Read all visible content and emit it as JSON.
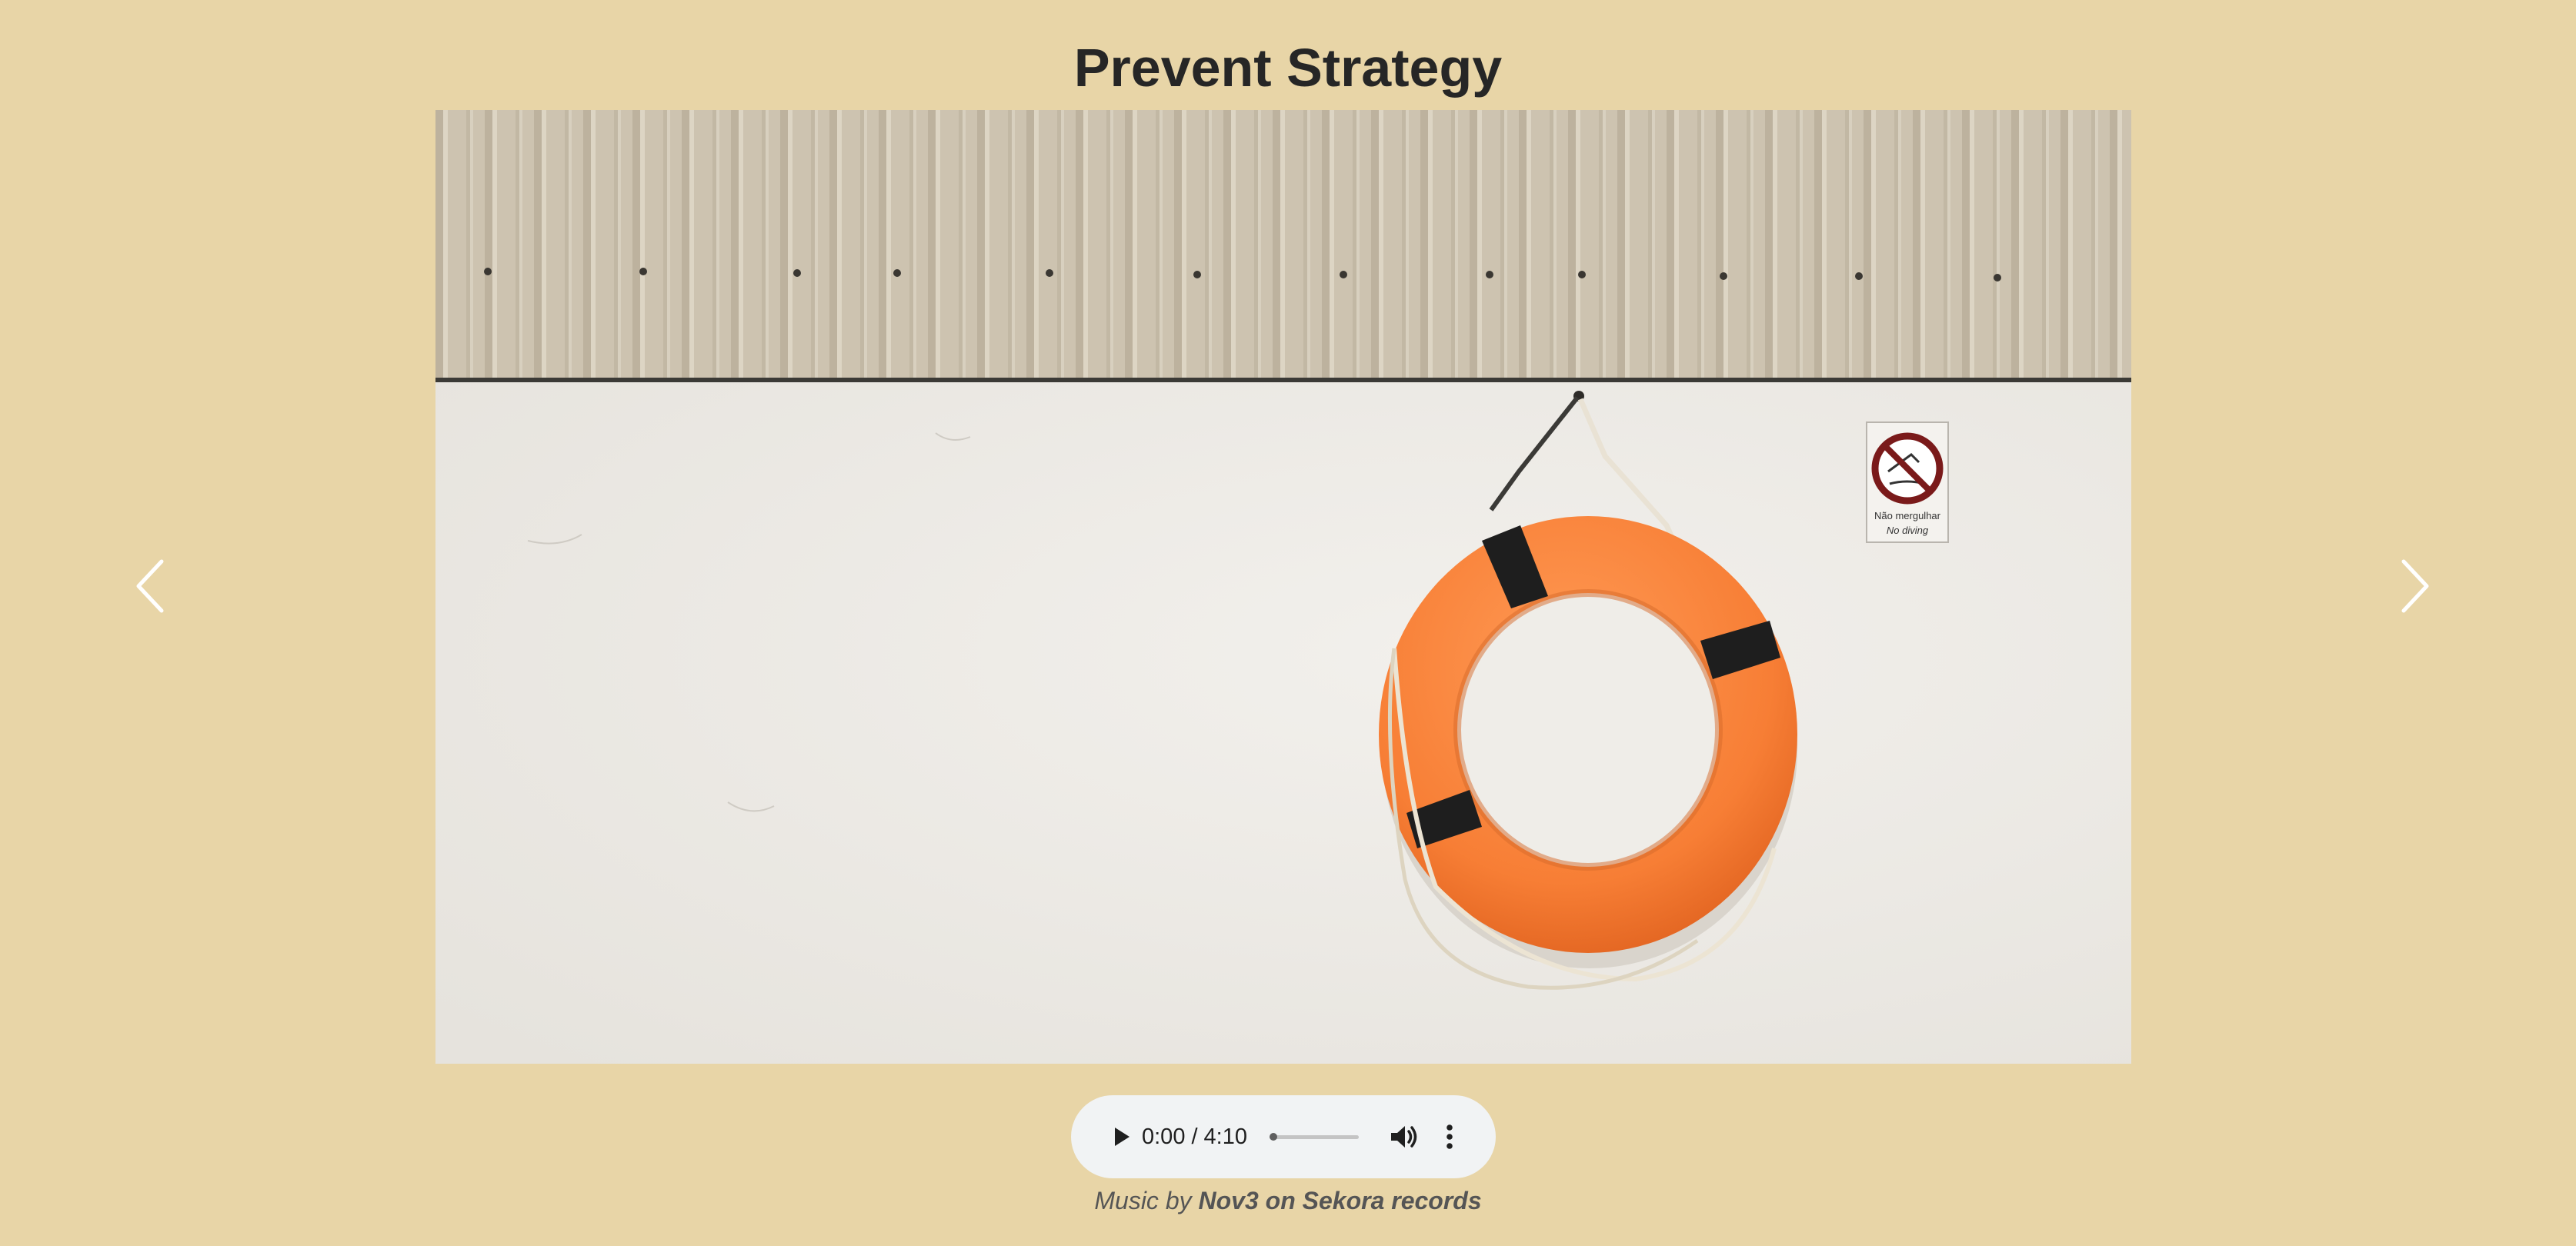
{
  "page": {
    "title": "Prevent Strategy",
    "background_color": "#e8d5a7"
  },
  "slideshow": {
    "prev_icon": "chevron-left-icon",
    "next_icon": "chevron-right-icon",
    "image": {
      "subject": "orange lifebuoy hanging on a white wall below a corrugated metal panel",
      "sign_text_line1": "Não mergulhar",
      "sign_text_line2": "No diving"
    }
  },
  "audio_player": {
    "current_time": "0:00",
    "separator": "/",
    "duration": "4:10",
    "progress": 0,
    "play_icon": "play-icon",
    "volume_icon": "volume-icon",
    "more_icon": "more-vertical-icon"
  },
  "credit": {
    "prefix": "Music by",
    "artist": "Nov3 on Sekora records"
  }
}
